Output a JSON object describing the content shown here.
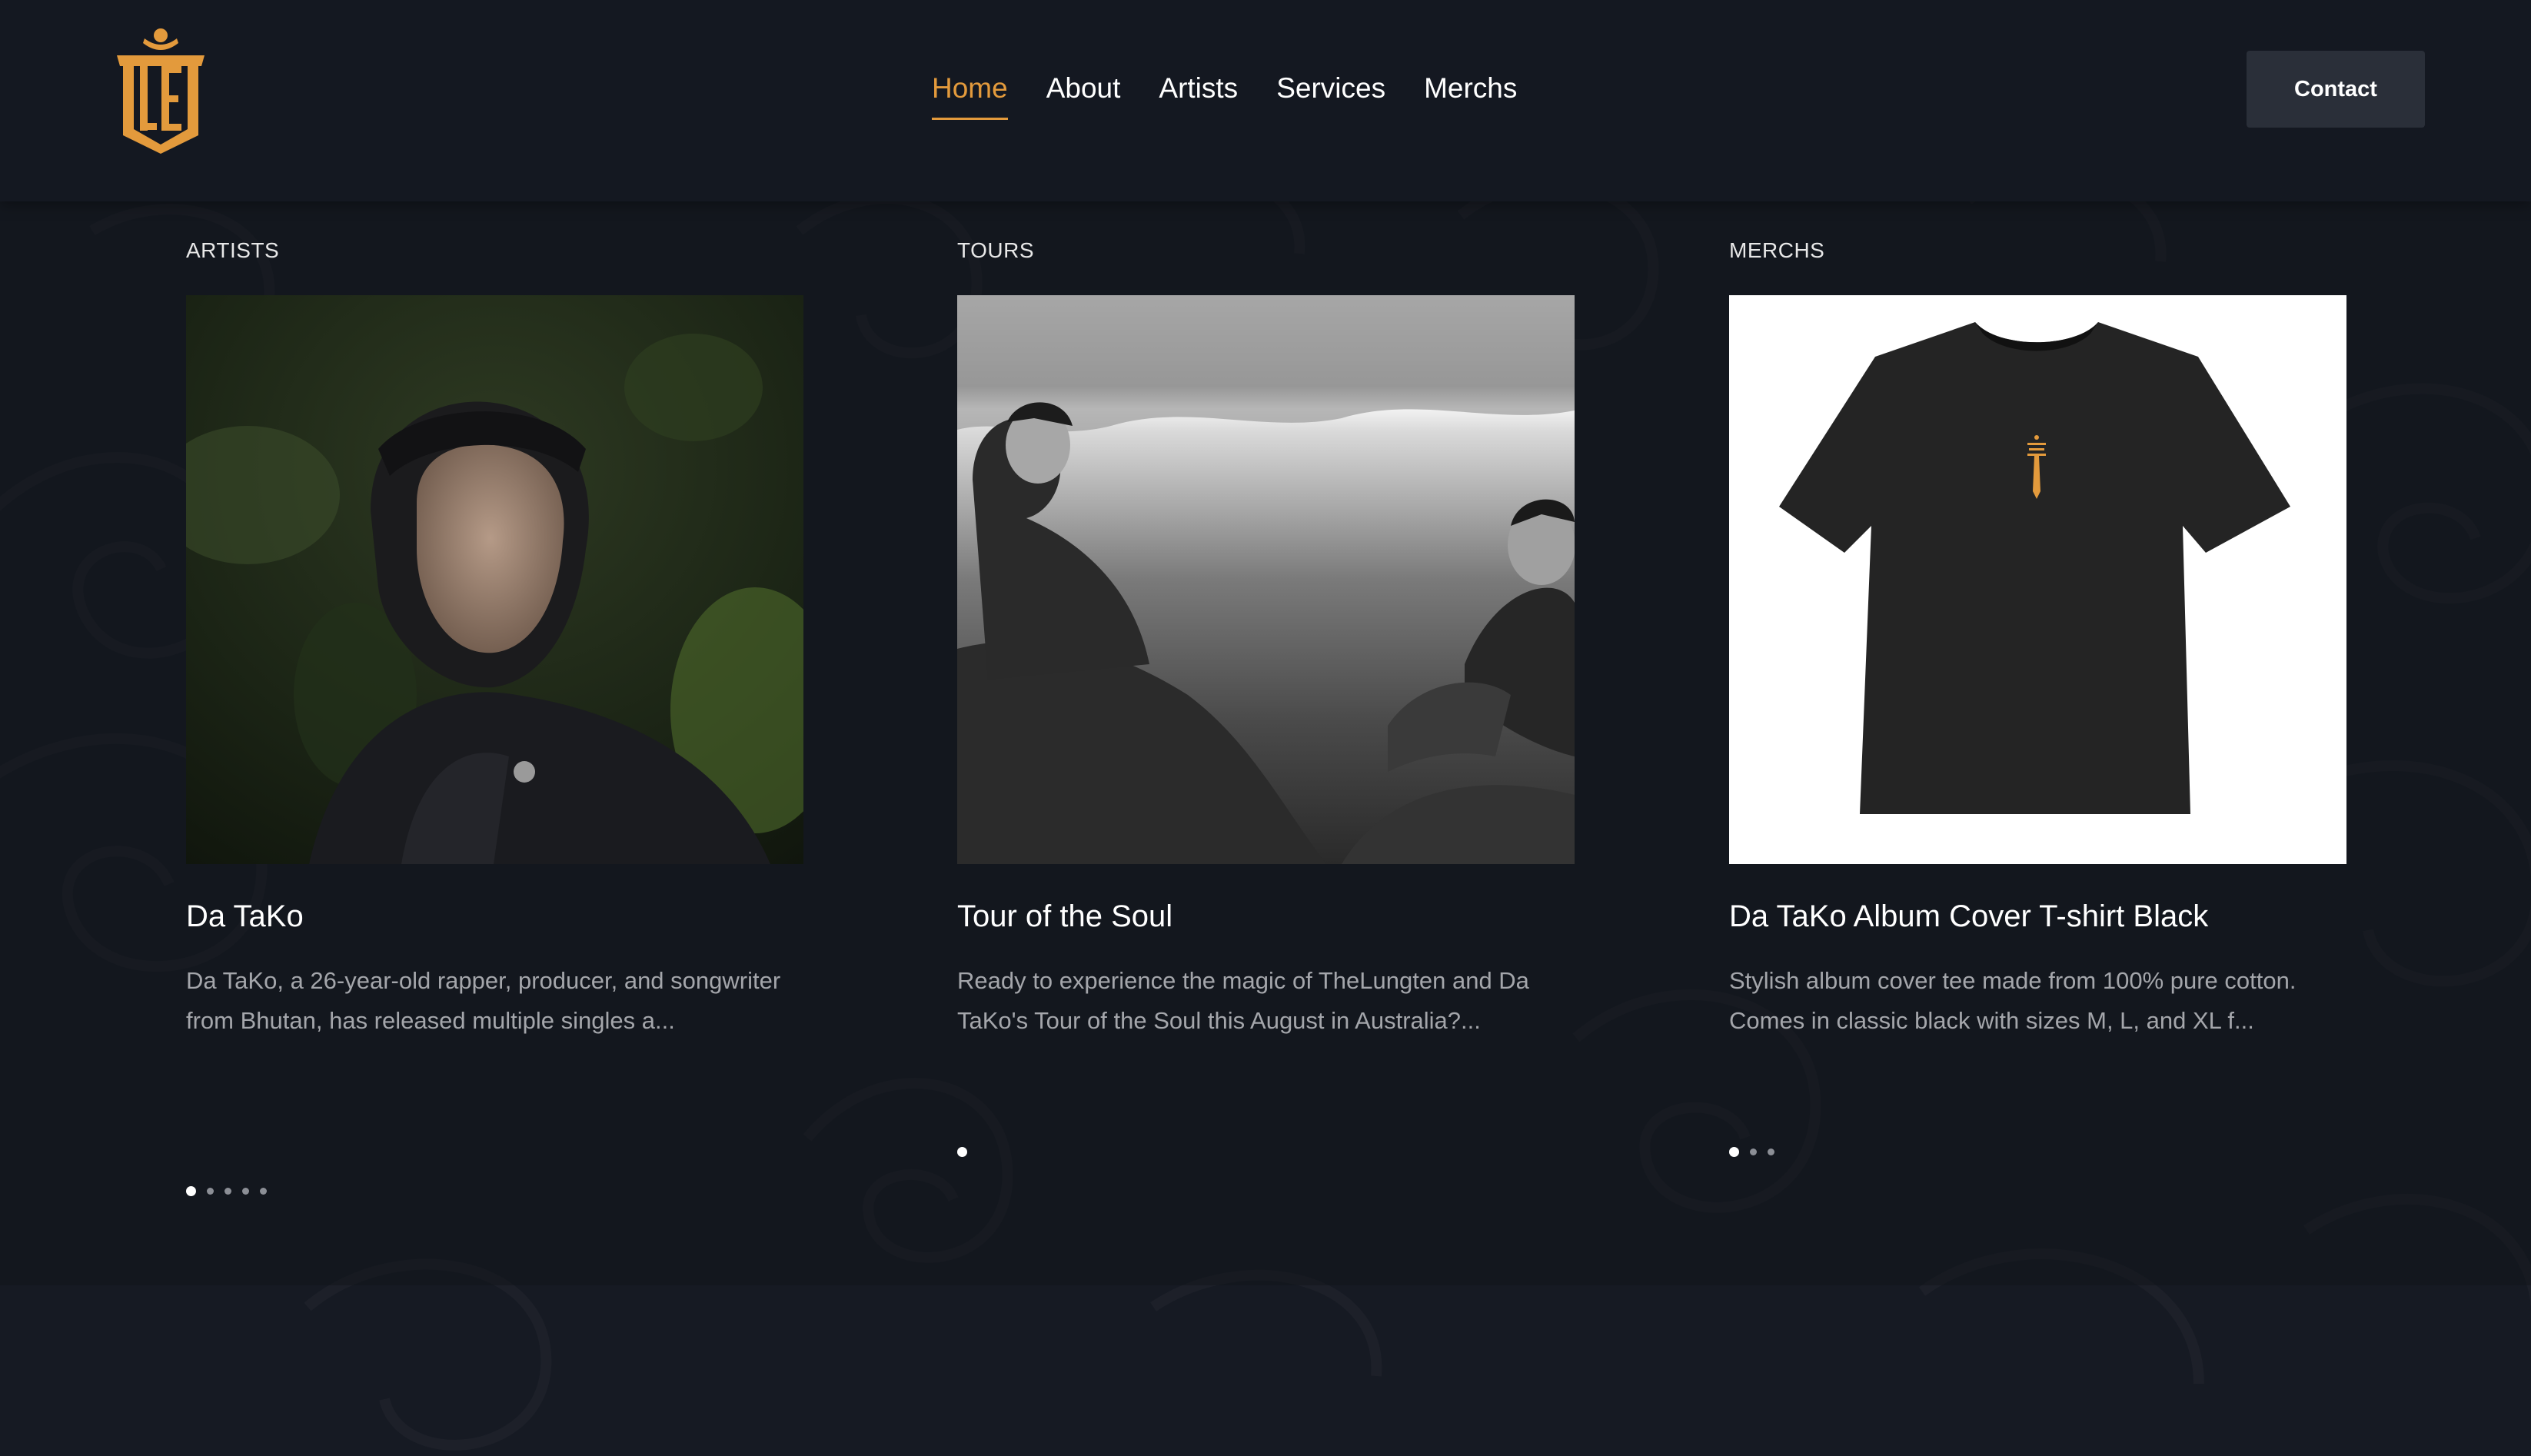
{
  "header": {
    "logo_alt": "TLE",
    "nav": [
      {
        "label": "Home",
        "active": true
      },
      {
        "label": "About",
        "active": false
      },
      {
        "label": "Artists",
        "active": false
      },
      {
        "label": "Services",
        "active": false
      },
      {
        "label": "Merchs",
        "active": false
      }
    ],
    "contact_label": "Contact"
  },
  "colors": {
    "accent": "#e39a3c",
    "background": "#161a23",
    "header_bg": "#141821",
    "button_bg": "#2a2f39"
  },
  "cards": [
    {
      "section": "ARTISTS",
      "image": "artist-portrait-photo",
      "title": "Da TaKo",
      "description": "Da TaKo, a 26-year-old rapper, producer, and songwriter from Bhutan, has released multiple singles a...",
      "dots_total": 5,
      "dots_active": 1
    },
    {
      "section": "TOURS",
      "image": "lake-bw-photo",
      "title": "Tour of the Soul",
      "description": "Ready to experience the magic of TheLungten and Da TaKo's Tour of the Soul this August in Australia?...",
      "dots_total": 1,
      "dots_active": 1
    },
    {
      "section": "MERCHS",
      "image": "black-tshirt-photo",
      "title": "Da TaKo Album Cover T-shirt Black",
      "description": "Stylish album cover tee made from 100% pure cotton. Comes in classic black with sizes M, L, and XL f...",
      "dots_total": 3,
      "dots_active": 1
    }
  ]
}
